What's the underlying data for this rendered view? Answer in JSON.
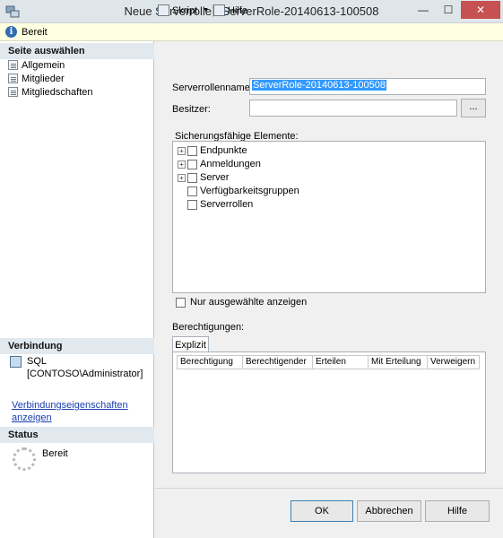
{
  "window": {
    "title": "Neue Serverrolle - ServerRole-20140613-100508",
    "minimize": "—",
    "maximize": "☐",
    "close": "✕"
  },
  "infobar": {
    "icon": "info-icon",
    "text": "Bereit"
  },
  "left": {
    "pages_header": "Seite auswählen",
    "pages": [
      "Allgemein",
      "Mitglieder",
      "Mitgliedschaften"
    ],
    "connection_header": "Verbindung",
    "connection_lines": [
      "SQL",
      "[CONTOSO\\Administrator]"
    ],
    "connection_link_lines": [
      "Verbindungseigenschaften",
      "anzeigen"
    ],
    "status_header": "Status",
    "status_text": "Bereit"
  },
  "toolbar": {
    "script_label": "Skript",
    "help_label": "Hilfe"
  },
  "form": {
    "name_label": "Serverrollenname:",
    "name_value": "ServerRole-20140613-100508",
    "owner_label": "Besitzer:",
    "owner_value": "",
    "browse_label": "...",
    "securables_label": "Sicherungsfähige Elemente:",
    "tree": [
      {
        "label": "Endpunkte",
        "expandable": true
      },
      {
        "label": "Anmeldungen",
        "expandable": true
      },
      {
        "label": "Server",
        "expandable": true
      },
      {
        "label": "Verfügbarkeitsgruppen",
        "expandable": false
      },
      {
        "label": "Serverrollen",
        "expandable": false
      }
    ],
    "only_selected_label": "Nur ausgewählte anzeigen",
    "permissions_label": "Berechtigungen:",
    "tab_label": "Explizit",
    "columns": [
      "Berechtigung",
      "Berechtigender",
      "Erteilen",
      "Mit Erteilung",
      "Verweigern"
    ]
  },
  "buttons": {
    "ok": "OK",
    "cancel": "Abbrechen",
    "help": "Hilfe"
  }
}
